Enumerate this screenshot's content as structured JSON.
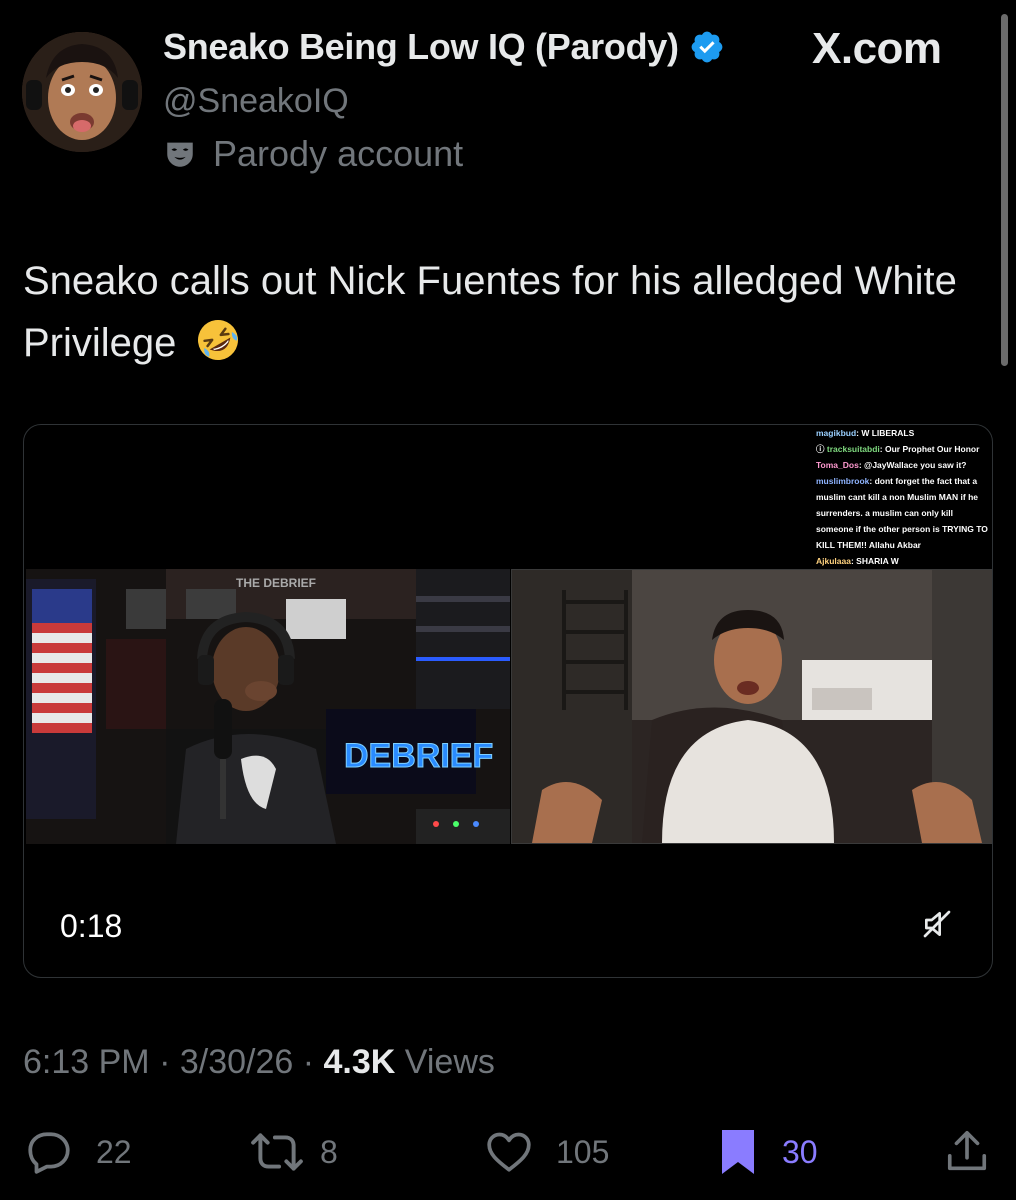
{
  "header": {
    "display_name": "Sneako Being Low IQ (Parody)",
    "handle": "@SneakoIQ",
    "parody_label": "Parody account",
    "site_label": "X.com"
  },
  "tweet": {
    "text": "Sneako calls out Nick Fuentes for his alledged White Privilege"
  },
  "video": {
    "duration": "0:18",
    "sign_text": "DEBRIEF",
    "banner_text": "THE DEBRIEF",
    "chat": [
      {
        "user": "magikbud",
        "message": "W LIBERALS",
        "user_color": "#9ad0ff"
      },
      {
        "user": "tracksuitabdi",
        "message": "Our Prophet Our Honor",
        "user_color": "#7fd97f"
      },
      {
        "user": "Toma_Dos",
        "message": "@JayWallace you saw it?",
        "user_color": "#ff9ad0"
      },
      {
        "user": "muslimbrook",
        "message": "dont forget the fact that a",
        "user_color": "#8fb4ff"
      },
      {
        "user": "",
        "message": "muslim cant kill a non Muslim MAN if he",
        "user_color": "#ffffff"
      },
      {
        "user": "",
        "message": "surrenders. a muslim can only kill",
        "user_color": "#ffffff"
      },
      {
        "user": "",
        "message": "someone if the other person is TRYING TO",
        "user_color": "#ffffff"
      },
      {
        "user": "",
        "message": "KILL THEM!! Allahu Akbar",
        "user_color": "#ffffff"
      },
      {
        "user": "Ajkulaaa",
        "message": "SHARIA W",
        "user_color": "#ffd27f"
      }
    ]
  },
  "meta": {
    "time": "6:13 PM",
    "sep1": " · ",
    "date": "3/30/26",
    "sep2": " · ",
    "views_count": "4.3K",
    "views_label": " Views"
  },
  "actions": {
    "replies": "22",
    "reposts": "8",
    "likes": "105",
    "bookmarks": "30"
  },
  "colors": {
    "background": "#000000",
    "text_primary": "#e7e9ea",
    "text_secondary": "#71767b",
    "verified_blue": "#1d9bf0",
    "bookmark_purple": "#8a7cff"
  },
  "icons": [
    "verified-badge-icon",
    "parody-mask-icon",
    "mute-icon",
    "reply-icon",
    "repost-icon",
    "like-icon",
    "bookmark-icon",
    "share-icon"
  ]
}
